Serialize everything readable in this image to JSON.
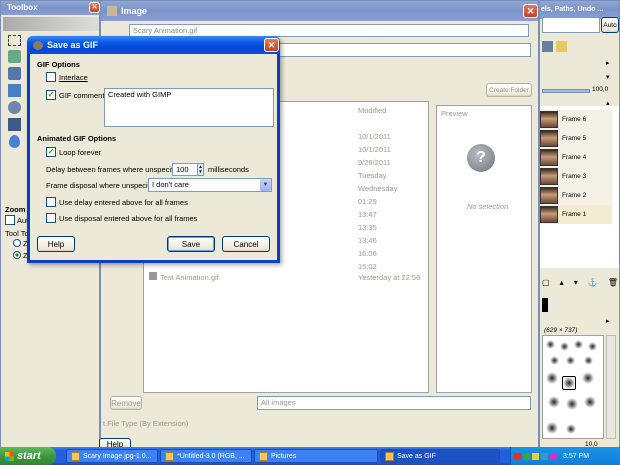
{
  "toolbox": {
    "title": "Toolbox",
    "zoom_heading": "Zoom",
    "auto_label": "Auto",
    "tool_toggle": "Tool Tog",
    "opt1": "Z",
    "opt2": "Z"
  },
  "image_dialog": {
    "title": "Image",
    "name_value": "Scary Animation.gif",
    "create_folder": "Create Folder",
    "modified_header": "Modified",
    "preview_header": "Preview",
    "no_selection": "No selection",
    "dates": [
      "10/1/2011",
      "10/1/2011",
      "9/29/2011",
      "Tuesday",
      "Wednesday",
      "01:29",
      "13:47",
      "13:35",
      "13:46",
      "16:06",
      "15:02",
      "Yesterday at 22:56"
    ],
    "file_name": "Test Animation.gif",
    "remove": "Remove",
    "all_images": "All images",
    "file_type": "t File Type (By Extension)",
    "help": "Help"
  },
  "layers_panel": {
    "title": "els, Paths, Undo ...",
    "auto": "Auto",
    "opacity": "100,0",
    "frames": [
      "Frame 6",
      "Frame 5",
      "Frame 4",
      "Frame 3",
      "Frame 2",
      "Frame 1"
    ],
    "brush_label": "(629 × 737)",
    "spacing": "10,0"
  },
  "save_dialog": {
    "title": "Save as GIF",
    "gif_options_heading": "GIF Options",
    "interlace_label": "Interlace",
    "interlace_checked": false,
    "gif_comment_label": "GIF comment:",
    "gif_comment_checked": true,
    "comment_text": "Created with GIMP",
    "animated_heading": "Animated GIF Options",
    "loop_label": "Loop forever",
    "loop_checked": true,
    "delay_label": "Delay between frames where unspecified:",
    "delay_value": "100",
    "delay_unit": "milliseconds",
    "disposal_label": "Frame disposal where unspecified:",
    "disposal_value": "I don't care",
    "use_delay_label": "Use delay entered above for all frames",
    "use_delay_checked": false,
    "use_disposal_label": "Use disposal entered above for all frames",
    "use_disposal_checked": false,
    "help_button": "Help",
    "save_button": "Save",
    "cancel_button": "Cancel"
  },
  "taskbar": {
    "start": "start",
    "items": [
      "Scary Image.jpg-1.0...",
      "*Untitled-3.0 (RGB, ...",
      "Pictures",
      "Save as GIF"
    ],
    "clock": "3:57 PM"
  },
  "colors": {
    "xp_blue": "#245edb",
    "dialog_bg": "#ece9d8",
    "taskbar": "#245edb",
    "start_green": "#3c9a3c"
  }
}
